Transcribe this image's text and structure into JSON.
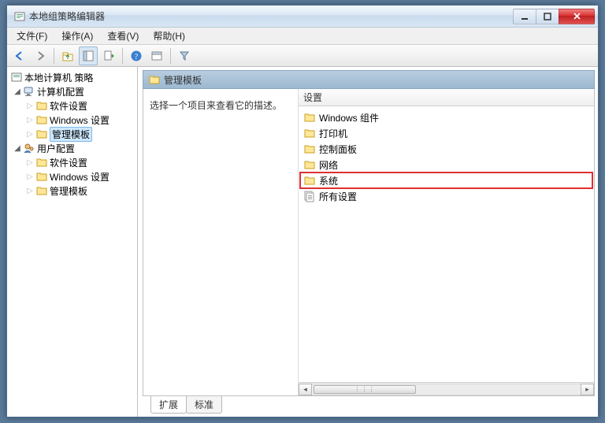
{
  "window": {
    "title": "本地组策略编辑器"
  },
  "menu": {
    "file": "文件(F)",
    "action": "操作(A)",
    "view": "查看(V)",
    "help": "帮助(H)"
  },
  "tree": {
    "root": "本地计算机 策略",
    "computer": "计算机配置",
    "user": "用户配置",
    "software": "软件设置",
    "windows_settings": "Windows 设置",
    "admin_templates": "管理模板"
  },
  "right": {
    "header": "管理模板",
    "description": "选择一个项目来查看它的描述。",
    "column": "设置",
    "items": [
      {
        "label": "Windows 组件",
        "type": "folder"
      },
      {
        "label": "打印机",
        "type": "folder"
      },
      {
        "label": "控制面板",
        "type": "folder"
      },
      {
        "label": "网络",
        "type": "folder"
      },
      {
        "label": "系统",
        "type": "folder",
        "highlight": true
      },
      {
        "label": "所有设置",
        "type": "settings"
      }
    ]
  },
  "tabs": {
    "extended": "扩展",
    "standard": "标准"
  }
}
